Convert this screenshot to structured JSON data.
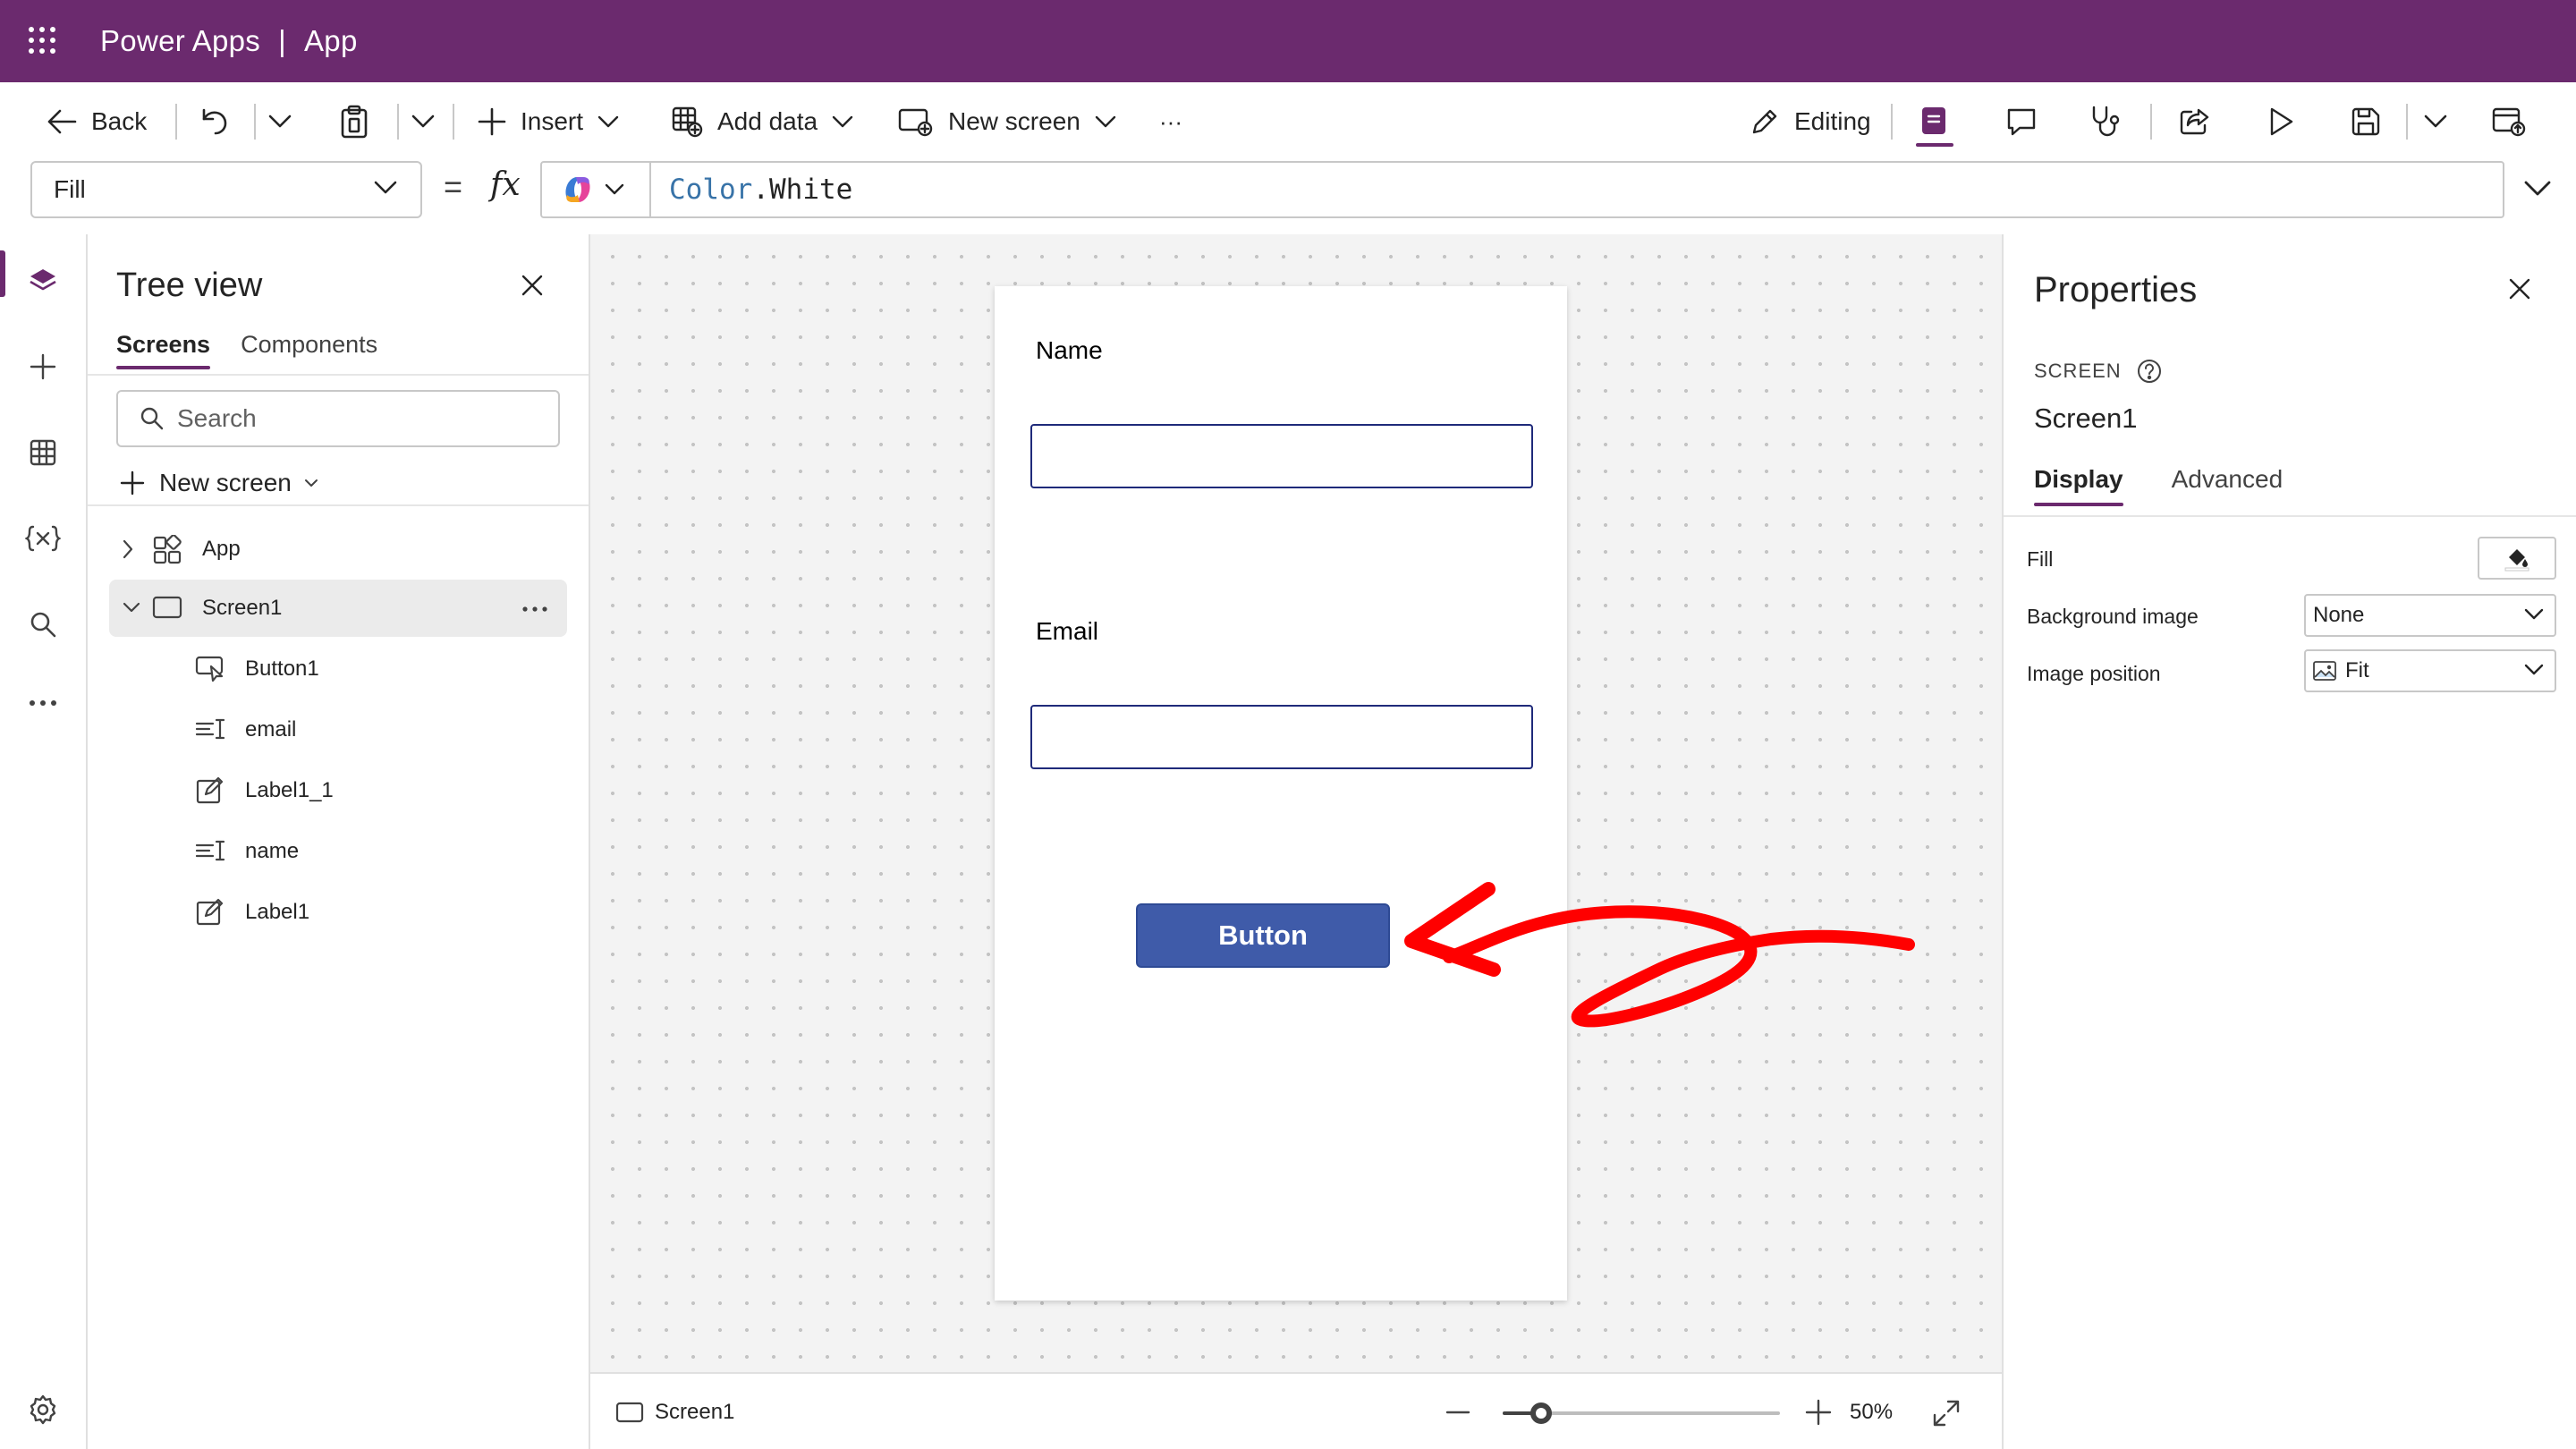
{
  "topbar": {
    "product": "Power Apps",
    "separator": "|",
    "app_name": "App"
  },
  "toolbar": {
    "back_label": "Back",
    "insert_label": "Insert",
    "add_data_label": "Add data",
    "new_screen_label": "New screen",
    "more_label": "···",
    "editing_label": "Editing"
  },
  "formula": {
    "property": "Fill",
    "equals": "=",
    "fx": "fx",
    "object": "Color",
    "dot": ".",
    "member": "White",
    "function_color": "#3873a8"
  },
  "tree": {
    "title": "Tree view",
    "tabs": [
      "Screens",
      "Components"
    ],
    "search_placeholder": "Search",
    "new_screen_label": "New screen",
    "nodes": [
      {
        "label": "App",
        "icon": "app-icon"
      },
      {
        "label": "Screen1",
        "icon": "screen-icon",
        "selected": true
      },
      {
        "label": "Button1",
        "icon": "button-control-icon"
      },
      {
        "label": "email",
        "icon": "text-input-icon"
      },
      {
        "label": "Label1_1",
        "icon": "label-icon"
      },
      {
        "label": "name",
        "icon": "text-input-icon"
      },
      {
        "label": "Label1",
        "icon": "label-icon"
      }
    ]
  },
  "canvas": {
    "name_label": "Name",
    "email_label": "Email",
    "button_label": "Button",
    "button_color": "#3f5ba9",
    "input_border_color": "#1f2a7a",
    "arrow_color": "#ff0000"
  },
  "status": {
    "screen": "Screen1",
    "zoom_value": "50%",
    "zoom_level": 0.5
  },
  "properties": {
    "title": "Properties",
    "type": "SCREEN",
    "name": "Screen1",
    "tabs": [
      "Display",
      "Advanced"
    ],
    "fill_label": "Fill",
    "bg_image_label": "Background image",
    "bg_image_value": "None",
    "image_position_label": "Image position",
    "image_position_value": "Fit"
  },
  "theme": {
    "brand": "#6b2a6e"
  }
}
